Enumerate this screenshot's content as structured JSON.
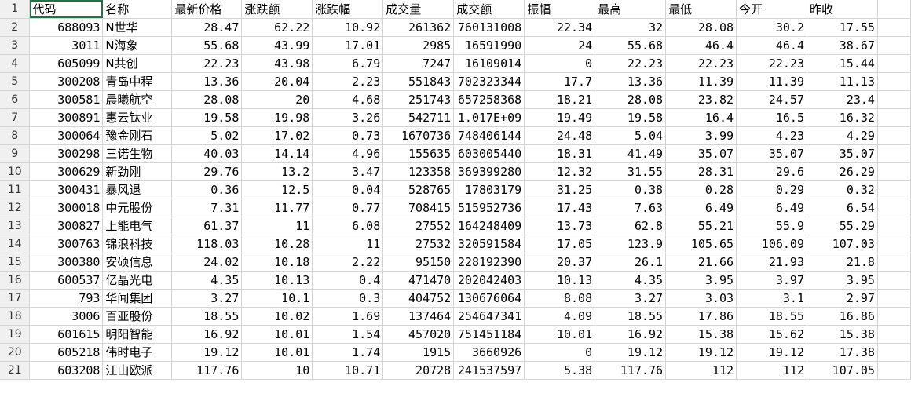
{
  "sheet": {
    "columns": [
      "代码",
      "名称",
      "最新价格",
      "涨跌额",
      "涨跌幅",
      "成交量",
      "成交额",
      "振幅",
      "最高",
      "最低",
      "今开",
      "昨收"
    ],
    "row_numbers": [
      "1",
      "2",
      "3",
      "4",
      "5",
      "6",
      "7",
      "8",
      "9",
      "10",
      "11",
      "12",
      "13",
      "14",
      "15",
      "16",
      "17",
      "18",
      "19",
      "20",
      "21"
    ],
    "selected_cell": "A1",
    "rows": [
      [
        "688093",
        "N世华",
        "28.47",
        "62.22",
        "10.92",
        "261362",
        "760131008",
        "22.34",
        "32",
        "28.08",
        "30.2",
        "17.55"
      ],
      [
        "3011",
        "N海象",
        "55.68",
        "43.99",
        "17.01",
        "2985",
        "16591990",
        "24",
        "55.68",
        "46.4",
        "46.4",
        "38.67"
      ],
      [
        "605099",
        "N共创",
        "22.23",
        "43.98",
        "6.79",
        "7247",
        "16109014",
        "0",
        "22.23",
        "22.23",
        "22.23",
        "15.44"
      ],
      [
        "300208",
        "青岛中程",
        "13.36",
        "20.04",
        "2.23",
        "551843",
        "702323344",
        "17.7",
        "13.36",
        "11.39",
        "11.39",
        "11.13"
      ],
      [
        "300581",
        "晨曦航空",
        "28.08",
        "20",
        "4.68",
        "251743",
        "657258368",
        "18.21",
        "28.08",
        "23.82",
        "24.57",
        "23.4"
      ],
      [
        "300891",
        "惠云钛业",
        "19.58",
        "19.98",
        "3.26",
        "542711",
        "1.017E+09",
        "19.49",
        "19.58",
        "16.4",
        "16.5",
        "16.32"
      ],
      [
        "300064",
        "豫金刚石",
        "5.02",
        "17.02",
        "0.73",
        "1670736",
        "748406144",
        "24.48",
        "5.04",
        "3.99",
        "4.23",
        "4.29"
      ],
      [
        "300298",
        "三诺生物",
        "40.03",
        "14.14",
        "4.96",
        "155635",
        "603005440",
        "18.31",
        "41.49",
        "35.07",
        "35.07",
        "35.07"
      ],
      [
        "300629",
        "新劲刚",
        "29.76",
        "13.2",
        "3.47",
        "123358",
        "369399280",
        "12.32",
        "31.55",
        "28.31",
        "29.6",
        "26.29"
      ],
      [
        "300431",
        "暴风退",
        "0.36",
        "12.5",
        "0.04",
        "528765",
        "17803179",
        "31.25",
        "0.38",
        "0.28",
        "0.29",
        "0.32"
      ],
      [
        "300018",
        "中元股份",
        "7.31",
        "11.77",
        "0.77",
        "708415",
        "515952736",
        "17.43",
        "7.63",
        "6.49",
        "6.49",
        "6.54"
      ],
      [
        "300827",
        "上能电气",
        "61.37",
        "11",
        "6.08",
        "27552",
        "164248409",
        "13.73",
        "62.8",
        "55.21",
        "55.9",
        "55.29"
      ],
      [
        "300763",
        "锦浪科技",
        "118.03",
        "10.28",
        "11",
        "27532",
        "320591584",
        "17.05",
        "123.9",
        "105.65",
        "106.09",
        "107.03"
      ],
      [
        "300380",
        "安硕信息",
        "24.02",
        "10.18",
        "2.22",
        "95150",
        "228192390",
        "20.37",
        "26.1",
        "21.66",
        "21.93",
        "21.8"
      ],
      [
        "600537",
        "亿晶光电",
        "4.35",
        "10.13",
        "0.4",
        "471470",
        "202042403",
        "10.13",
        "4.35",
        "3.95",
        "3.97",
        "3.95"
      ],
      [
        "793",
        "华闻集团",
        "3.27",
        "10.1",
        "0.3",
        "404752",
        "130676064",
        "8.08",
        "3.27",
        "3.03",
        "3.1",
        "2.97"
      ],
      [
        "3006",
        "百亚股份",
        "18.55",
        "10.02",
        "1.69",
        "137464",
        "254647341",
        "4.09",
        "18.55",
        "17.86",
        "18.55",
        "16.86"
      ],
      [
        "601615",
        "明阳智能",
        "16.92",
        "10.01",
        "1.54",
        "457020",
        "751451184",
        "10.01",
        "16.92",
        "15.38",
        "15.62",
        "15.38"
      ],
      [
        "605218",
        "伟时电子",
        "19.12",
        "10.01",
        "1.74",
        "1915",
        "3660926",
        "0",
        "19.12",
        "19.12",
        "19.12",
        "17.38"
      ],
      [
        "603208",
        "江山欧派",
        "117.76",
        "10",
        "10.71",
        "20728",
        "241537597",
        "5.38",
        "117.76",
        "112",
        "112",
        "107.05"
      ]
    ]
  }
}
